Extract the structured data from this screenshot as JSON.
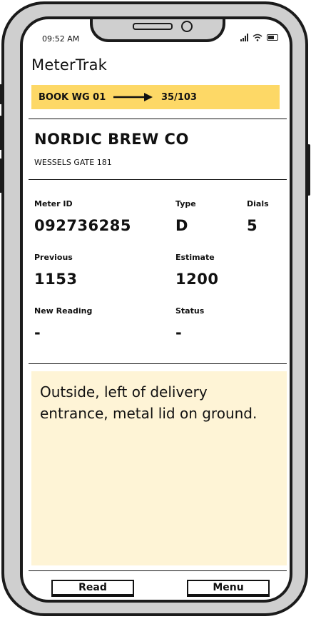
{
  "status_bar": {
    "time": "09:52 AM"
  },
  "app": {
    "title": "MeterTrak"
  },
  "book": {
    "name": "BOOK WG 01",
    "progress": "35/103"
  },
  "customer": {
    "name": "NORDIC BREW CO",
    "address": "WESSELS GATE 181"
  },
  "meter": {
    "id_label": "Meter ID",
    "id_value": "092736285",
    "type_label": "Type",
    "type_value": "D",
    "dials_label": "Dials",
    "dials_value": "5",
    "previous_label": "Previous",
    "previous_value": "1153",
    "estimate_label": "Estimate",
    "estimate_value": "1200",
    "new_reading_label": "New Reading",
    "new_reading_value": "-",
    "status_label": "Status",
    "status_value": "-"
  },
  "note": {
    "text": "Outside, left of delivery entrance, metal lid on ground."
  },
  "buttons": {
    "read": "Read",
    "menu": "Menu"
  },
  "colors": {
    "book_bar": "#fdd866",
    "note_bg": "#fef4d6",
    "frame": "#cfcfcf"
  }
}
